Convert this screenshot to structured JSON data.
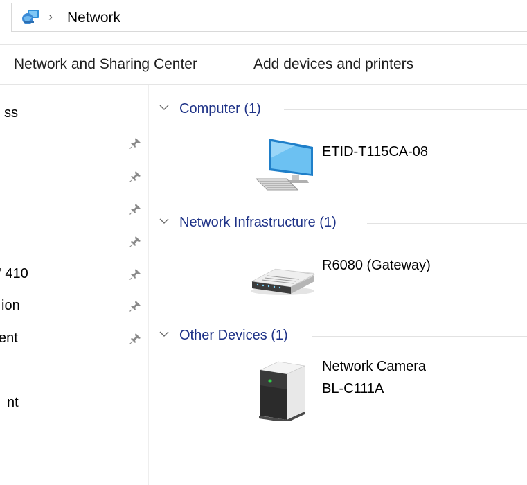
{
  "address_bar": {
    "location_icon": "network-globe-icon",
    "separator": "›",
    "crumb": "Network"
  },
  "command_bar": {
    "items": [
      "Network and Sharing Center",
      "Add devices and printers"
    ]
  },
  "nav_pane": {
    "items": [
      {
        "label": "ss",
        "pinned": false
      },
      {
        "label": "",
        "pinned": true
      },
      {
        "label": "",
        "pinned": true
      },
      {
        "label": "",
        "pinned": true
      },
      {
        "label": "",
        "pinned": true
      },
      {
        "label": "' 410",
        "pinned": true
      },
      {
        "label": "ion",
        "pinned": true
      },
      {
        "label": "ent",
        "pinned": true
      },
      {
        "label": "nt",
        "pinned": false
      }
    ]
  },
  "groups": [
    {
      "title": "Computer (1)",
      "devices": [
        {
          "name_lines": [
            "ETID-T115CA-08"
          ],
          "icon": "computer-icon"
        }
      ]
    },
    {
      "title": "Network Infrastructure (1)",
      "devices": [
        {
          "name_lines": [
            "R6080 (Gateway)"
          ],
          "icon": "router-icon"
        }
      ]
    },
    {
      "title": "Other Devices (1)",
      "devices": [
        {
          "name_lines": [
            "Network Camera",
            "BL-C111A"
          ],
          "icon": "network-device-icon"
        }
      ]
    }
  ]
}
